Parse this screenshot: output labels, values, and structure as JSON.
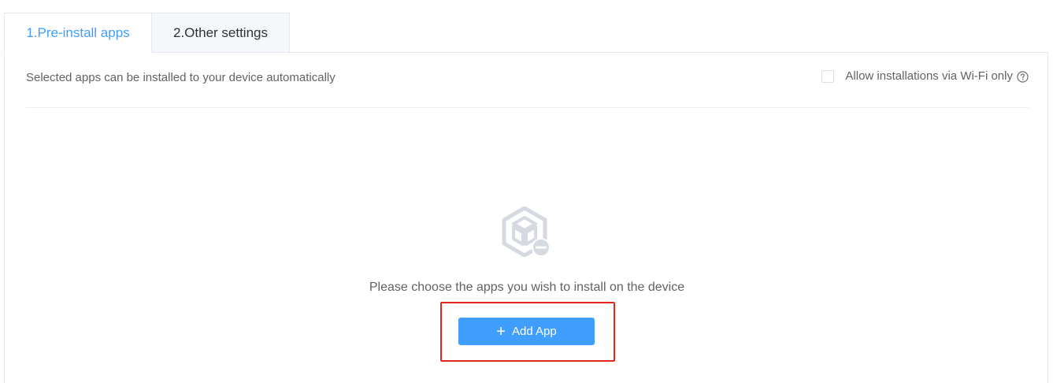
{
  "tabs": [
    {
      "label": "1.Pre-install apps",
      "active": true
    },
    {
      "label": "2.Other settings",
      "active": false
    }
  ],
  "panel": {
    "description": "Selected apps can be installed to your device automatically",
    "wifi_only": {
      "label": "Allow installations via Wi-Fi only",
      "checked": false,
      "help_icon": "question-circle-icon"
    },
    "empty_state": {
      "icon": "package-remove-icon",
      "message": "Please choose the apps you wish to install on the device"
    },
    "add_button": {
      "icon": "plus-icon",
      "label": "Add App"
    }
  },
  "colors": {
    "accent": "#409eff",
    "highlight": "#e8251b",
    "text": "#606266",
    "border": "#e4e7ed"
  }
}
